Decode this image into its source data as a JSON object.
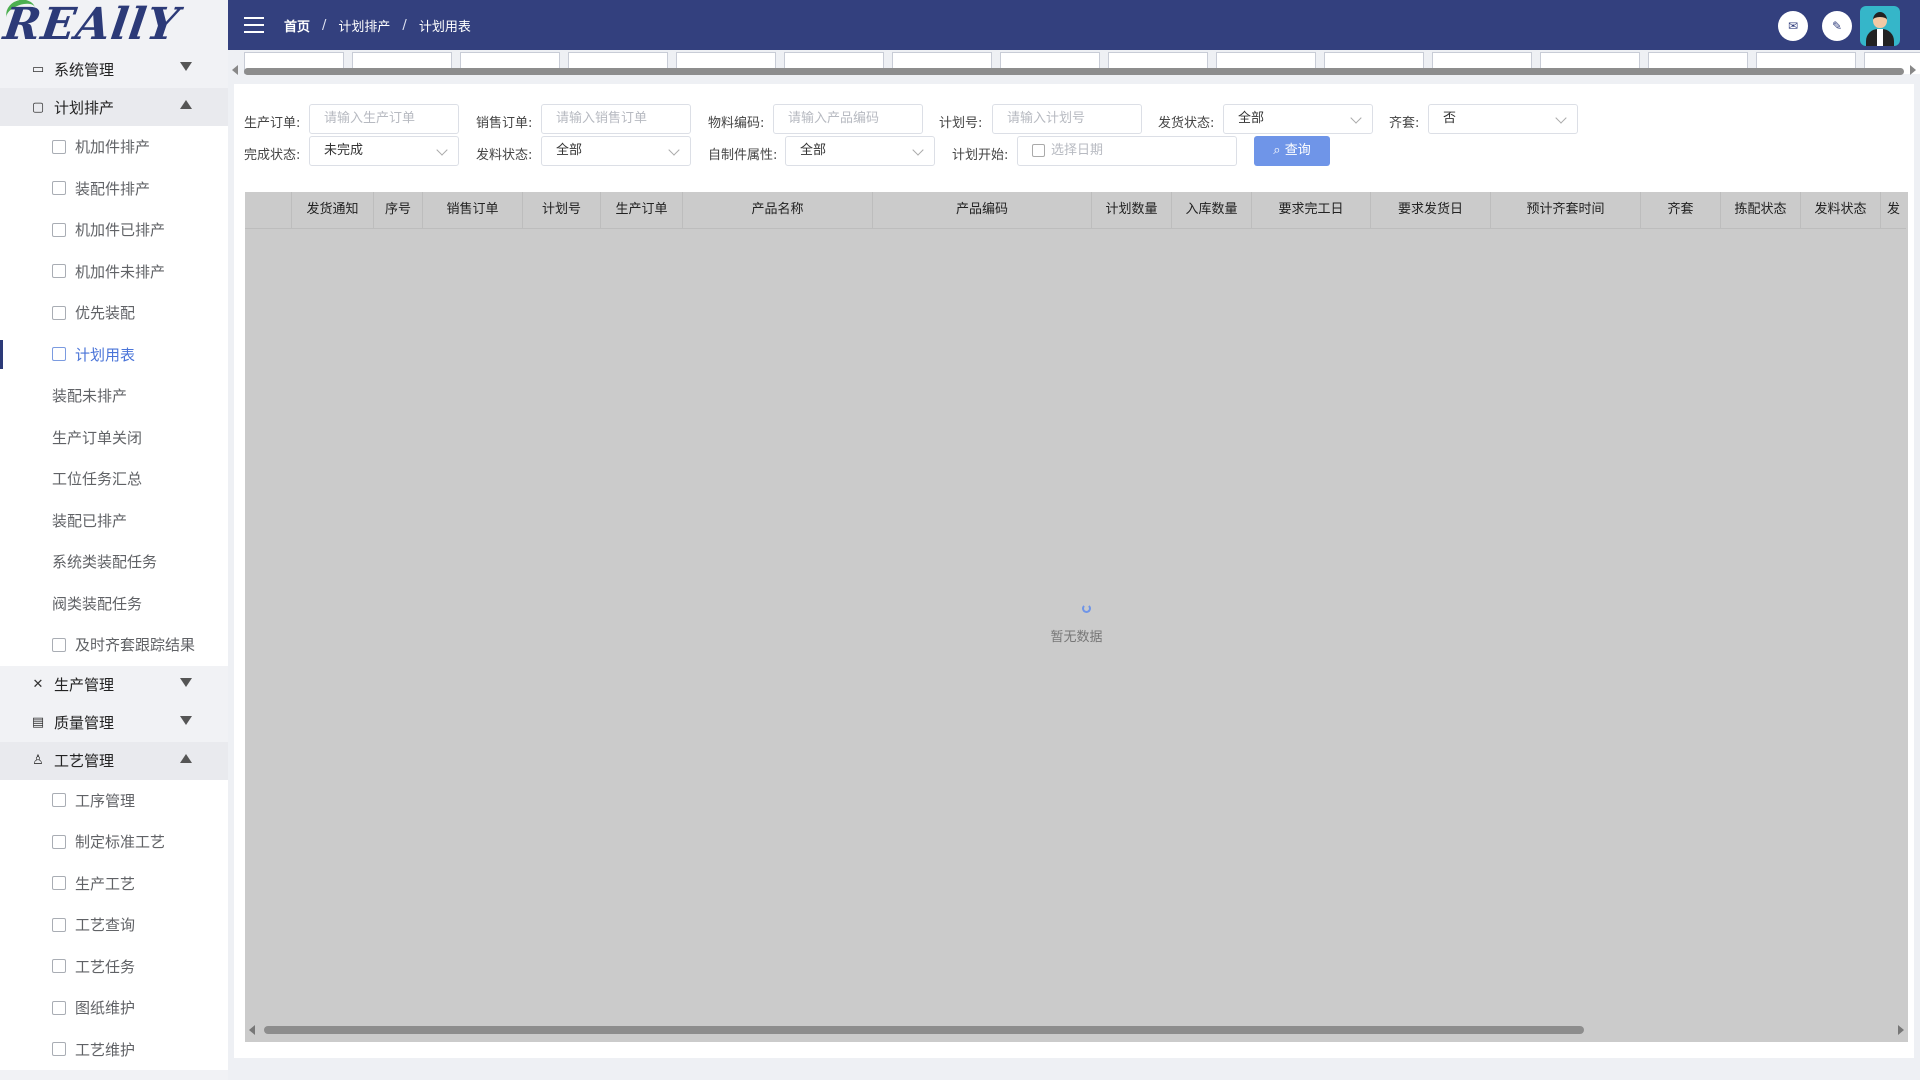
{
  "brand": {
    "logo_text": "REAllY"
  },
  "sidebar": {
    "groups": [
      {
        "label": "系统管理",
        "icon": "monitor-icon"
      },
      {
        "label": "计划排产",
        "icon": "plan-icon"
      },
      {
        "label": "生产管理",
        "icon": "tools-icon"
      },
      {
        "label": "质量管理",
        "icon": "quality-icon"
      },
      {
        "label": "工艺管理",
        "icon": "craft-icon"
      }
    ],
    "plan_items": [
      {
        "label": "机加件排产"
      },
      {
        "label": "装配件排产"
      },
      {
        "label": "机加件已排产"
      },
      {
        "label": "机加件未排产"
      },
      {
        "label": "优先装配"
      },
      {
        "label": "计划用表"
      },
      {
        "label": "装配未排产"
      },
      {
        "label": "生产订单关闭"
      },
      {
        "label": "工位任务汇总"
      },
      {
        "label": "装配已排产"
      },
      {
        "label": "系统类装配任务"
      },
      {
        "label": "阀类装配任务"
      },
      {
        "label": "及时齐套跟踪结果"
      }
    ],
    "craft_items": [
      {
        "label": "工序管理"
      },
      {
        "label": "制定标准工艺"
      },
      {
        "label": "生产工艺"
      },
      {
        "label": "工艺查询"
      },
      {
        "label": "工艺任务"
      },
      {
        "label": "图纸维护"
      },
      {
        "label": "工艺维护"
      }
    ]
  },
  "header": {
    "breadcrumb": [
      "首页",
      "计划排产",
      "计划用表"
    ],
    "separator": "/",
    "mail_icon": "✉",
    "edit_icon": "✎"
  },
  "filters": {
    "prod_order_label": "生产订单:",
    "prod_order_placeholder": "请输入生产订单",
    "sales_order_label": "销售订单:",
    "sales_order_placeholder": "请输入销售订单",
    "material_label": "物料编码:",
    "material_placeholder": "请输入产品编码",
    "plan_no_label": "计划号:",
    "plan_no_placeholder": "请输入计划号",
    "ship_status_label": "发货状态:",
    "ship_status_value": "全部",
    "kit_label": "齐套:",
    "kit_value": "否",
    "done_status_label": "完成状态:",
    "done_status_value": "未完成",
    "issue_status_label": "发料状态:",
    "issue_status_value": "全部",
    "self_made_label": "自制件属性:",
    "self_made_value": "全部",
    "plan_start_label": "计划开始:",
    "plan_start_placeholder": "选择日期",
    "query_button": "查询"
  },
  "table": {
    "columns": [
      "",
      "发货通知",
      "序号",
      "销售订单",
      "计划号",
      "生产订单",
      "产品名称",
      "产品编码",
      "计划数量",
      "入库数量",
      "要求完工日",
      "要求发货日",
      "预计齐套时间",
      "齐套",
      "拣配状态",
      "发料状态",
      "发"
    ],
    "empty_text": "暂无数据"
  },
  "colors": {
    "header_bg": "#33407e",
    "accent": "#4a74d8",
    "query_btn": "#6f95e8"
  }
}
